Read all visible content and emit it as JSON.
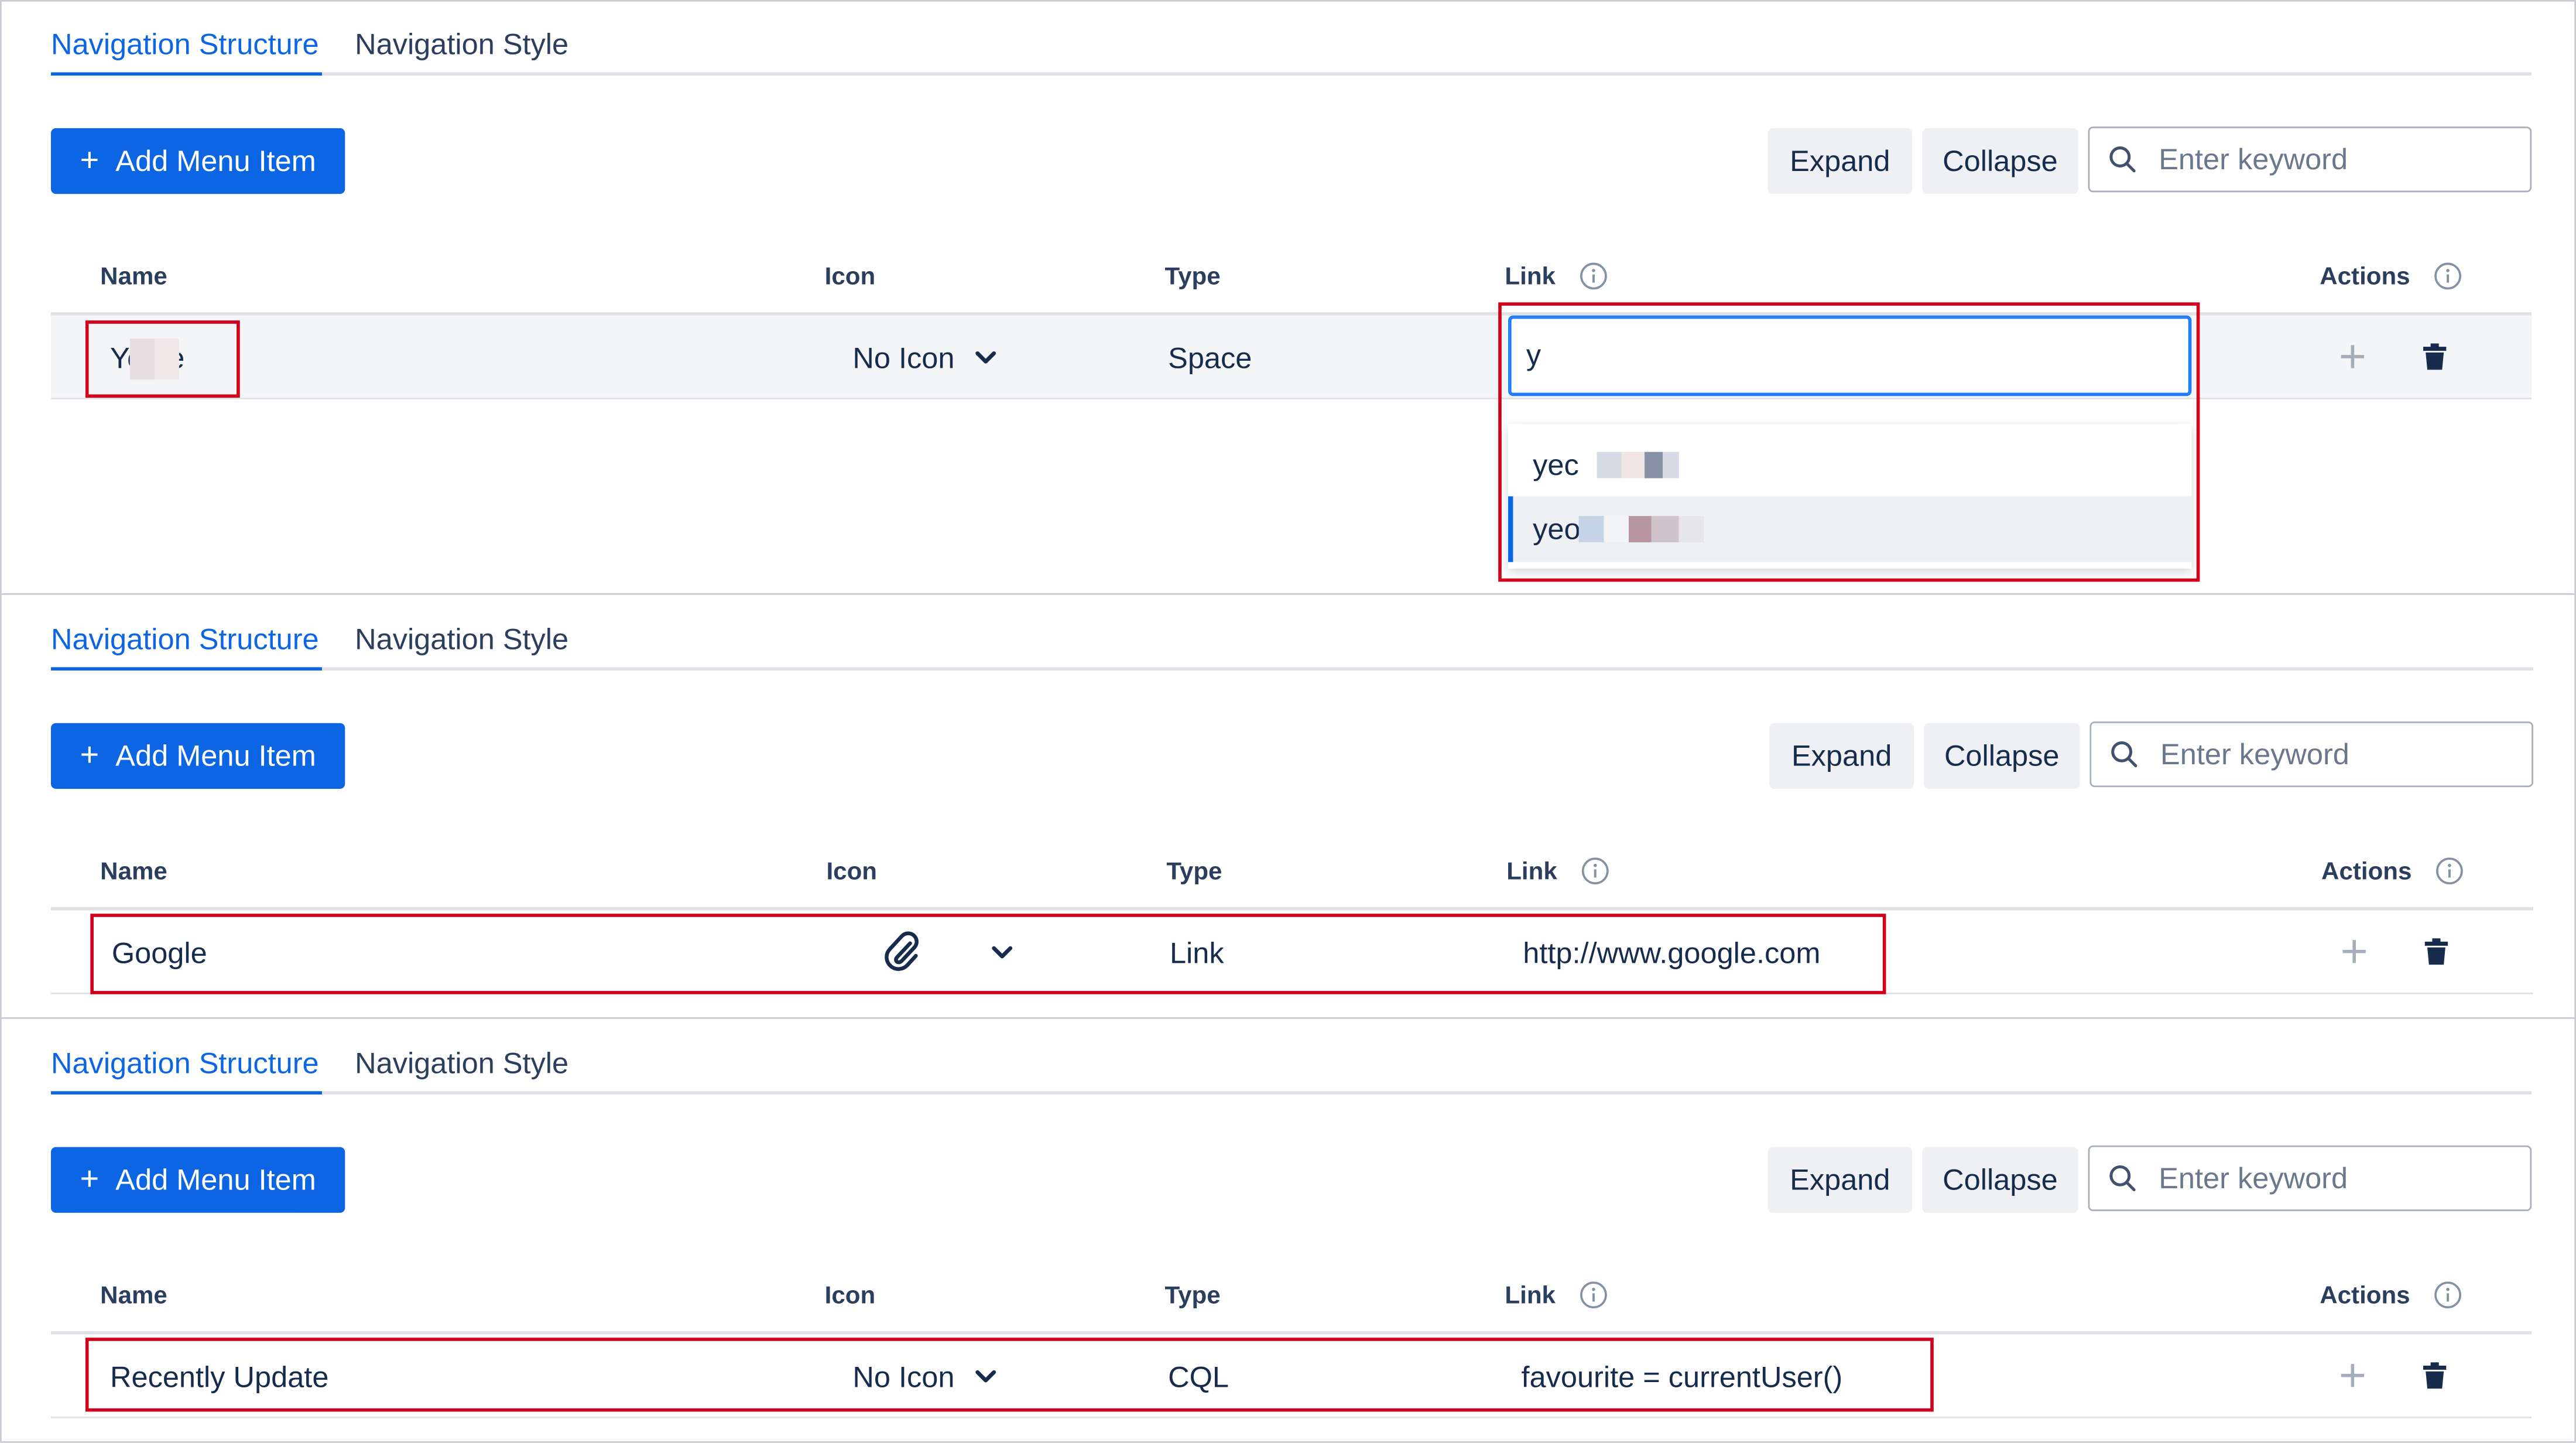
{
  "tabs": {
    "structure": "Navigation Structure",
    "style": "Navigation Style"
  },
  "toolbar": {
    "add_label": "Add Menu Item",
    "expand_label": "Expand",
    "collapse_label": "Collapse",
    "search_placeholder": "Enter keyword"
  },
  "columns": {
    "name": "Name",
    "icon": "Icon",
    "type": "Type",
    "link": "Link",
    "actions": "Actions"
  },
  "colors": {
    "accent": "#0c66e4",
    "highlight_border": "#d0021b",
    "row_bg": "#f4f5f7"
  },
  "panels": [
    {
      "row": {
        "name": "Ye  ee",
        "icon": "No Icon",
        "type": "Space",
        "link_value": "y"
      },
      "suggestions": [
        {
          "text": "yec",
          "selected": false
        },
        {
          "text": "yeo",
          "selected": true
        }
      ]
    },
    {
      "row": {
        "name": "Google",
        "icon_name": "paperclip-icon",
        "type": "Link",
        "link": "http://www.google.com"
      }
    },
    {
      "row": {
        "name": "Recently Update",
        "icon": "No Icon",
        "type": "CQL",
        "link": "favourite = currentUser()"
      }
    }
  ]
}
